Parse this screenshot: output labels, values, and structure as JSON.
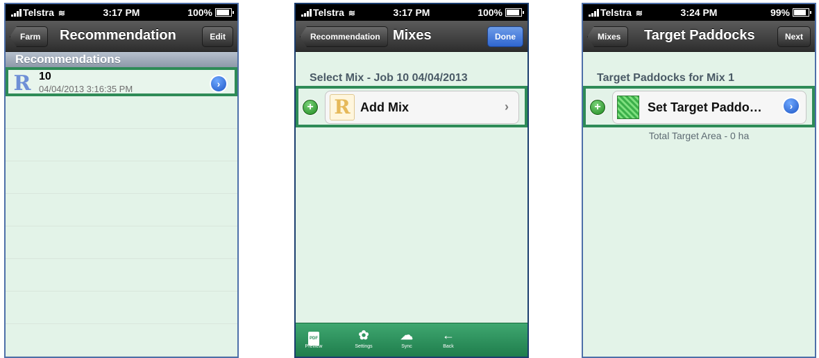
{
  "screens": [
    {
      "status": {
        "carrier": "Telstra",
        "time": "3:17 PM",
        "battery": "100%"
      },
      "nav": {
        "back": "Farm",
        "title": "Recommendation",
        "right": "Edit"
      },
      "section": "Recommendations",
      "row": {
        "icon": "R",
        "title": "10",
        "subtitle": "04/04/2013 3:16:35 PM"
      }
    },
    {
      "status": {
        "carrier": "Telstra",
        "time": "3:17 PM",
        "battery": "100%"
      },
      "nav": {
        "back": "Recommendation",
        "title": "Mixes",
        "right": "Done"
      },
      "heading": "Select Mix - Job 10 04/04/2013",
      "cell": {
        "icon": "R",
        "label": "Add Mix"
      },
      "toolbar": [
        {
          "icon": "PDF",
          "label": "Preview"
        },
        {
          "icon": "✿",
          "label": "Settings"
        },
        {
          "icon": "☁",
          "label": "Sync"
        },
        {
          "icon": "←",
          "label": "Back"
        }
      ]
    },
    {
      "status": {
        "carrier": "Telstra",
        "time": "3:24 PM",
        "battery": "99%"
      },
      "nav": {
        "back": "Mixes",
        "title": "Target Paddocks",
        "right": "Next"
      },
      "heading": "Target Paddocks for Mix 1",
      "cell": {
        "label": "Set Target Paddo…"
      },
      "total": "Total Target Area - 0 ha"
    }
  ],
  "colors": {
    "highlight": "#2e8b57",
    "list_bg": "#e3f3e8",
    "toolbar": "#2a8c58"
  }
}
